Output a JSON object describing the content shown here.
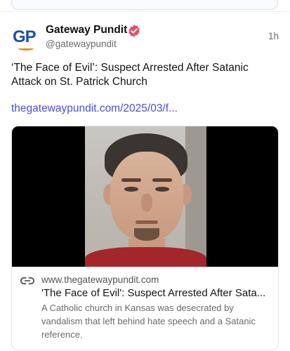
{
  "post": {
    "author_name": "Gateway Pundit",
    "author_handle": "@gatewaypundit",
    "avatar_initials": "GP",
    "time": "1h",
    "text": "‘The Face of Evil’: Suspect Arrested After Satanic Attack on St. Patrick Church",
    "link_text": "thegatewaypundit.com/2025/03/f..."
  },
  "card": {
    "domain": "www.thegatewaypundit.com",
    "title": "'The Face of Evil': Suspect Arrested After Sata...",
    "description": "A Catholic church in Kansas was desecrated by vandalism that left behind hate speech and a Satanic reference."
  },
  "icons": {
    "verified": "verified-badge-icon",
    "link": "link-icon"
  },
  "colors": {
    "link": "#4a4ee0",
    "verified_badge": "#e94d6a",
    "avatar_text": "#1f4fa8",
    "avatar_accent": "#e98a1c"
  }
}
